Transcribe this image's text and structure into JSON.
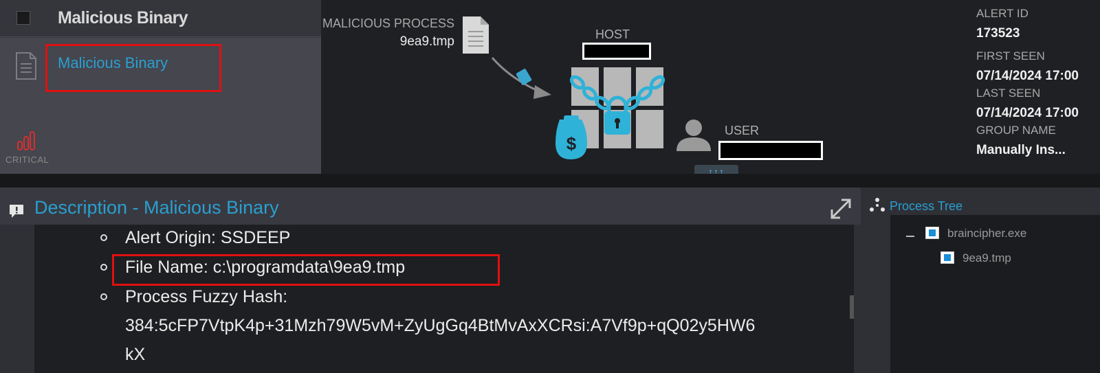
{
  "alert_list": {
    "header_title": "Malicious Binary",
    "row_link": "Malicious Binary",
    "severity": "CRITICAL"
  },
  "graph": {
    "process_label": "MALICIOUS PROCESS",
    "process_value": "9ea9.tmp",
    "host_label": "HOST",
    "user_label": "USER",
    "expand_label": "↑↑↑"
  },
  "info": {
    "alert_id_label": "ALERT ID",
    "alert_id": "173523",
    "first_seen_label": "FIRST SEEN",
    "first_seen": "07/14/2024 17:00",
    "last_seen_label": "LAST SEEN",
    "last_seen": "07/14/2024 17:00",
    "group_name_label": "GROUP NAME",
    "group_name": "Manually Ins..."
  },
  "description": {
    "title": "Description - Malicious Binary",
    "lines": [
      "Alert Origin: SSDEEP",
      "File Name: c:\\programdata\\9ea9.tmp",
      "Process Fuzzy Hash:",
      "384:5cFP7VtpK4p+31Mzh79W5vM+ZyUgGq4BtMvAxXCRsi:A7Vf9p+qQ02y5HW6",
      "kX"
    ]
  },
  "process_tree": {
    "title": "Process Tree",
    "nodes": [
      "braincipher.exe",
      "9ea9.tmp"
    ]
  },
  "colors": {
    "accent": "#2a9fd0",
    "highlight": "#e01010"
  }
}
